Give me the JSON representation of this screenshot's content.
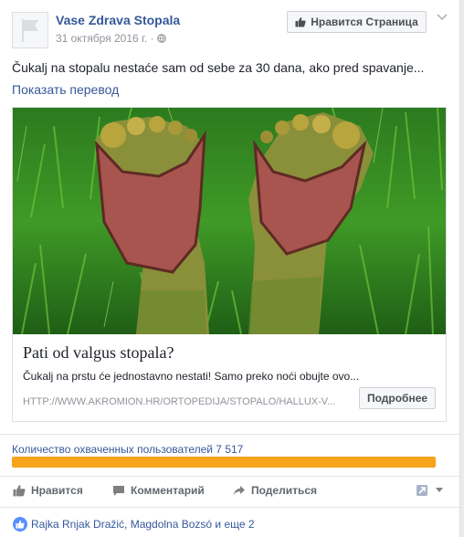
{
  "header": {
    "page_name": "Vase Zdrava Stopala",
    "date": "31 октября 2016 г.",
    "separator": "·",
    "like_page_label": "Нравится Страница"
  },
  "post": {
    "text": "Čukalj na stopalu nestaće sam od sebe za 30 dana, ako pred spavanje...",
    "translate_label": "Показать перевод"
  },
  "link": {
    "title": "Pati od valgus stopala?",
    "description": "Čukalj na prstu će jednostavno nestati! Samo preko noći obujte ovo...",
    "domain": "HTTP://WWW.AKROMION.HR/ORTOPEDIJA/STOPALO/HALLUX-V...",
    "button_label": "Подробнее"
  },
  "reach": {
    "label": "Количество охваченных пользователей 7 517",
    "bar_fill_fraction": 1.0,
    "bar_color": "#f7a31c"
  },
  "actions": {
    "like": "Нравится",
    "comment": "Комментарий",
    "share": "Поделиться"
  },
  "reactions": {
    "text": "Rajka Rnjak Dražić, Magdolna Bozsó и еще 2"
  },
  "colors": {
    "link_blue": "#365899",
    "meta_gray": "#90949c",
    "boost_orange": "#f7a31c"
  },
  "icons": [
    "flag-avatar-icon",
    "globe-icon",
    "thumbs-up-icon",
    "chevron-down-icon",
    "comment-icon",
    "share-icon",
    "boost-icon"
  ]
}
